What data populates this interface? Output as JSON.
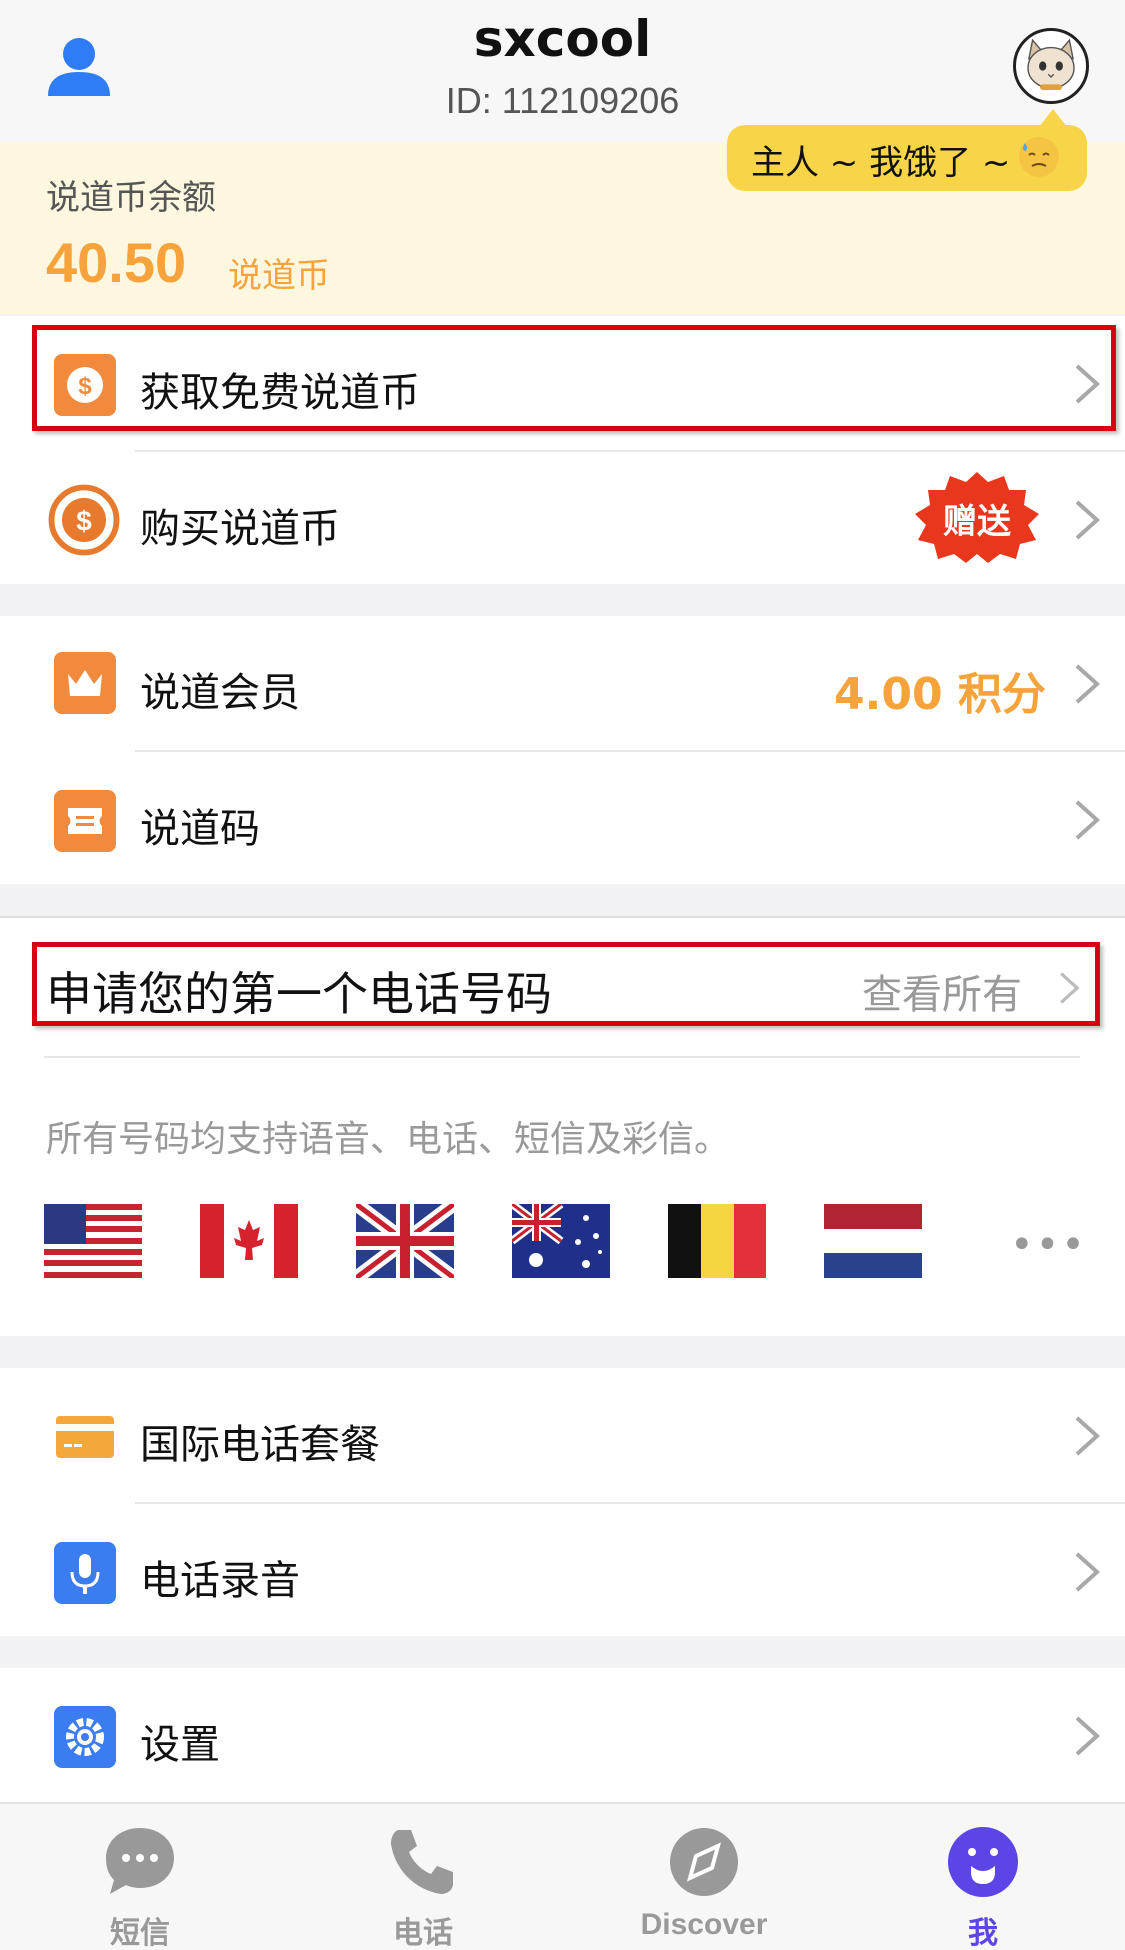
{
  "header": {
    "username": "sxcool",
    "user_id": "ID: 112109206",
    "bubble": "主人 ~ 我饿了 ~"
  },
  "balance": {
    "label": "说道币余额",
    "value": "40.50",
    "unit": "说道币"
  },
  "coins": {
    "get_free": "获取免费说道币",
    "buy": "购买说道币",
    "buy_badge": "赠送"
  },
  "membership": {
    "member": "说道会员",
    "points": "4.00 积分",
    "code": "说道码"
  },
  "phone": {
    "title": "申请您的第一个电话号码",
    "view_all": "查看所有",
    "description": "所有号码均支持语音、电话、短信及彩信。",
    "flags": [
      "us-flag",
      "canada-flag",
      "uk-flag",
      "australia-flag",
      "belgium-flag",
      "netherlands-flag"
    ],
    "more": "•••"
  },
  "services": {
    "intl_plan": "国际电话套餐",
    "recording": "电话录音"
  },
  "settings": {
    "label": "设置"
  },
  "tabbar": {
    "items": [
      {
        "label": "短信",
        "icon": "chat-bubble-icon"
      },
      {
        "label": "电话",
        "icon": "phone-icon"
      },
      {
        "label": "Discover",
        "icon": "compass-icon"
      },
      {
        "label": "我",
        "icon": "smiley-icon"
      }
    ],
    "active_color": "#5b45e6"
  },
  "colors": {
    "accent": "#f5a33a",
    "highlight": "#d80010",
    "badge": "#e8371c"
  }
}
